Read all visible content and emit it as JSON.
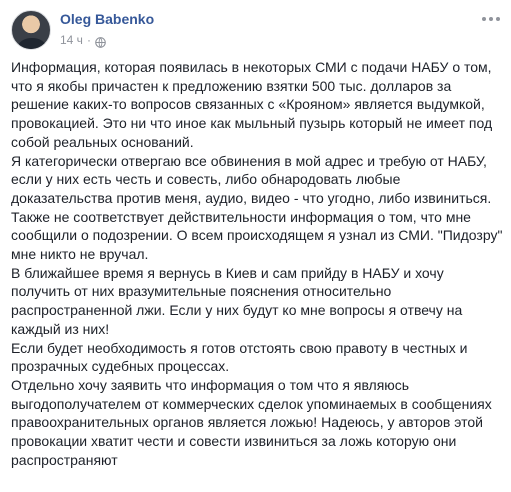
{
  "post": {
    "author": "Oleg Babenko",
    "timestamp": "14 ч",
    "dot": "·",
    "paragraphs": [
      "Информация, которая появилась в некоторых СМИ с подачи НАБУ о том, что я якобы причастен к предложению взятки 500 тыс. долларов за решение каких-то вопросов связанных с «Крояном» является выдумкой, провокацией. Это ни что иное как мыльный пузырь который не имеет под собой реальных оснований.",
      "Я категорически отвергаю все обвинения в мой адрес и требую от НАБУ, если у них есть честь и совесть, либо обнародовать любые доказательства против меня, аудио, видео - что угодно, либо извиниться.",
      "Также не соответствует действительности информация о том, что мне сообщили о подозрении. О всем происходящем я узнал из СМИ. \"Пидозру\" мне никто не вручал.",
      "В ближайшее время я вернусь в Киев и сам прийду в НАБУ и хочу получить от них вразумительные пояснения относительно распространенной лжи. Если у них будут ко мне вопросы я отвечу на каждый из них!",
      "Если будет необходимость я готов отстоять свою правоту в честных и прозрачных судебных процессах.",
      "Отдельно хочу заявить что информация о том что я являюсь выгодополучателем от коммерческих сделок упоминаемых в сообщениях правоохранительных органов является ложью! Надеюсь, у авторов этой провокации хватит чести и совести извиниться за ложь которую они распространяют"
    ]
  },
  "icons": {
    "privacy": "globe-icon",
    "menu": "more-options-icon"
  },
  "colors": {
    "author_link": "#365899",
    "meta_text": "#90949c",
    "body_text": "#1d2129"
  }
}
